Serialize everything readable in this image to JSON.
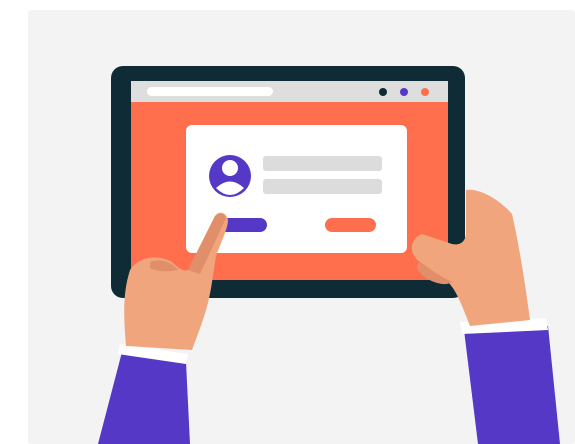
{
  "illustration": {
    "subject": "hands-holding-tablet-login",
    "icons": [
      "address-bar",
      "window-dot-dark",
      "window-dot-purple",
      "window-dot-orange",
      "user-avatar-icon",
      "finger-pointing-icon"
    ]
  },
  "colors": {
    "background": "#f3f3f4",
    "tablet_frame": "#0e2b36",
    "browser_bar": "#dededf",
    "address_field": "#ffffff",
    "screen": "#ff6f4e",
    "card": "#ffffff",
    "placeholder_line": "#dcdcdc",
    "accent_purple": "#5638c6",
    "accent_orange": "#ff6f4e",
    "dot_dark": "#0e2b36",
    "skin": "#f0a57d",
    "skin_shade": "#e08f6a",
    "cuff": "#ffffff",
    "sleeve": "#5638c6"
  }
}
